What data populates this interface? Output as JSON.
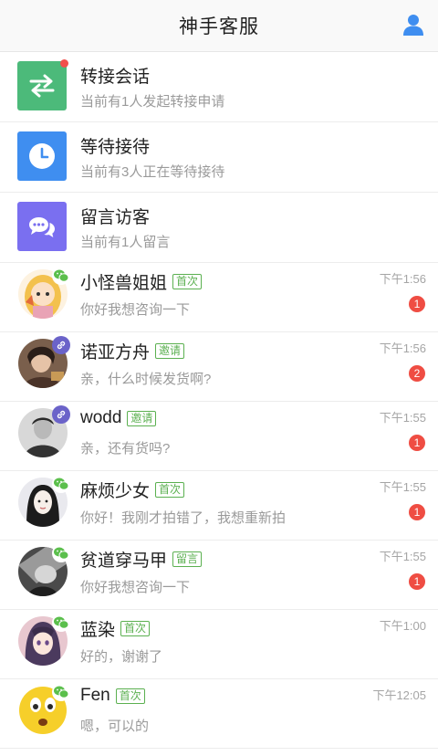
{
  "header": {
    "title": "神手客服",
    "user_icon": "user-icon"
  },
  "system_items": [
    {
      "title": "转接会话",
      "subtitle": "当前有1人发起转接申请",
      "icon": "swap-icon",
      "color": "#4cba7a",
      "dot": true
    },
    {
      "title": "等待接待",
      "subtitle": "当前有3人正在等待接待",
      "icon": "clock-icon",
      "color": "#3f8ef0",
      "dot": false
    },
    {
      "title": "留言访客",
      "subtitle": "当前有1人留言",
      "icon": "chat-bubbles-icon",
      "color": "#7a6ff0",
      "dot": false
    }
  ],
  "chats": [
    {
      "name": "小怪兽姐姐",
      "tag": "首次",
      "message": "你好我想咨询一下",
      "time": "下午1:56",
      "unread": "1",
      "channel": "wechat-icon"
    },
    {
      "name": "诺亚方舟",
      "tag": "邀请",
      "message": "亲，什么时候发货啊?",
      "time": "下午1:56",
      "unread": "2",
      "channel": "link-icon"
    },
    {
      "name": "wodd",
      "tag": "邀请",
      "message": "亲，还有货吗?",
      "time": "下午1:55",
      "unread": "1",
      "channel": "link-icon"
    },
    {
      "name": "麻烦少女",
      "tag": "首次",
      "message": "你好！我刚才拍错了，我想重新拍",
      "time": "下午1:55",
      "unread": "1",
      "channel": "wechat-icon"
    },
    {
      "name": "贫道穿马甲",
      "tag": "留言",
      "message": "你好我想咨询一下",
      "time": "下午1:55",
      "unread": "1",
      "channel": "wechat-icon"
    },
    {
      "name": "蓝染",
      "tag": "首次",
      "message": "好的，谢谢了",
      "time": "下午1:00",
      "unread": "",
      "channel": "wechat-icon"
    },
    {
      "name": "Fen",
      "tag": "首次",
      "message": "嗯，可以的",
      "time": "下午12:05",
      "unread": "",
      "channel": "wechat-icon"
    }
  ],
  "colors": {
    "accent": "#3f8ef0",
    "unread": "#ef4d43",
    "tag": "#5bb050",
    "link_badge": "#6b63c9"
  }
}
